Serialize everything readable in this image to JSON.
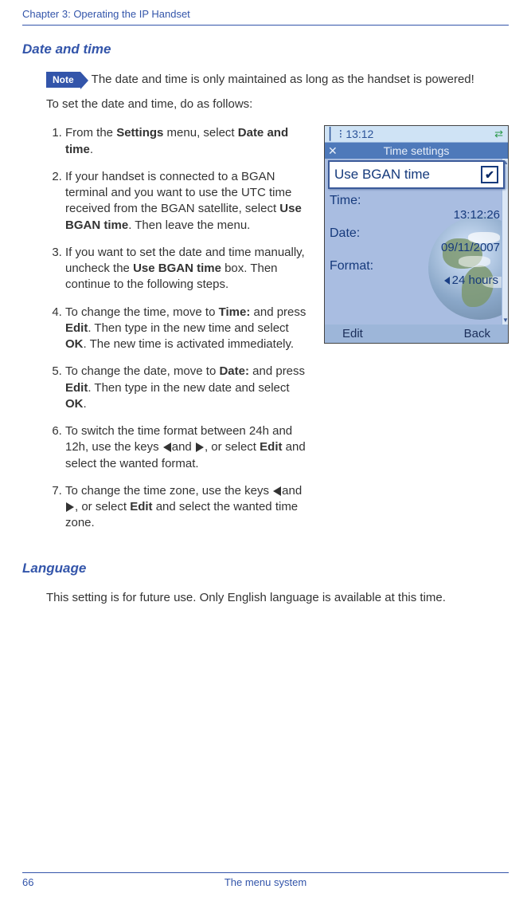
{
  "header": {
    "chapter": "Chapter 3:  Operating the IP Handset"
  },
  "section1": {
    "title": "Date and time",
    "note_label": "Note",
    "note_text": "The date and time is only maintained as long as the handset is powered!",
    "intro": "To set the date and time, do as follows:",
    "steps": {
      "s1a": "From the ",
      "s1b": "Settings",
      "s1c": " menu, select ",
      "s1d": "Date and time",
      "s1e": ".",
      "s2a": "If your handset is connected to a BGAN terminal and you want to use the UTC time received from the BGAN satellite, select ",
      "s2b": "Use BGAN time",
      "s2c": ". Then leave the menu.",
      "s3a": "If you want to set the date and time manually, uncheck the ",
      "s3b": "Use BGAN time",
      "s3c": " box. Then continue to the following steps.",
      "s4a": "To change the time, move to ",
      "s4b": "Time:",
      "s4c": " and press ",
      "s4d": "Edit",
      "s4e": ". Then type in the new time and select ",
      "s4f": "OK",
      "s4g": ". The new time is activated immediately.",
      "s5a": "To change the date, move to ",
      "s5b": "Date:",
      "s5c": " and press ",
      "s5d": "Edit",
      "s5e": ". Then type in the new date and select ",
      "s5f": "OK",
      "s5g": ".",
      "s6a": "To switch the time format between 24h and 12h, use the keys ",
      "s6b": "and  ",
      "s6c": ", or select ",
      "s6d": "Edit",
      "s6e": " and select the wanted format.",
      "s7a": "To change the time zone, use the keys ",
      "s7b": "and  ",
      "s7c": ", or select ",
      "s7d": "Edit",
      "s7e": " and select the wanted time zone."
    }
  },
  "phone": {
    "clock": "13:12",
    "title": "Time settings",
    "bgan_label": "Use BGAN time",
    "time_label": "Time:",
    "time_value": "13:12:26",
    "date_label": "Date:",
    "date_value": "09/11/2007",
    "format_label": "Format:",
    "format_value": "24 hours",
    "soft_left": "Edit",
    "soft_right": "Back"
  },
  "section2": {
    "title": "Language",
    "text": "This setting is for future use. Only English language is available at this time."
  },
  "footer": {
    "page": "66",
    "label": "The menu system"
  }
}
